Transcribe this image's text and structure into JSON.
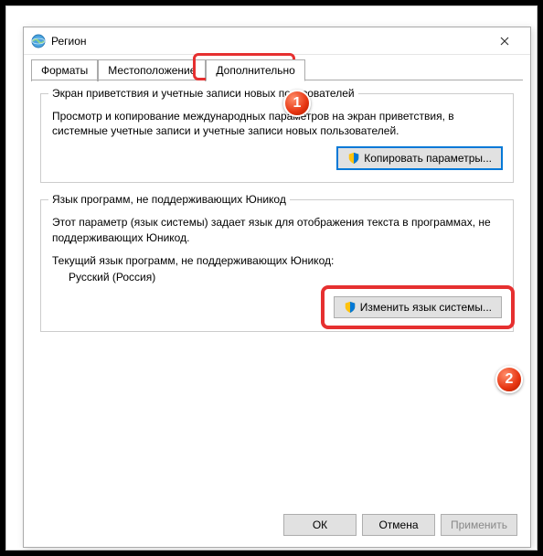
{
  "window": {
    "title": "Регион"
  },
  "tabs": {
    "formats": "Форматы",
    "location": "Местоположение",
    "advanced": "Дополнительно"
  },
  "group1": {
    "legend": "Экран приветствия и учетные записи новых пользователей",
    "desc": "Просмотр и копирование международных параметров на экран приветствия, в системные учетные записи и учетные записи новых пользователей.",
    "button": "Копировать параметры..."
  },
  "group2": {
    "legend": "Язык программ, не поддерживающих Юникод",
    "desc": "Этот параметр (язык системы) задает язык для отображения текста в программах, не поддерживающих Юникод.",
    "current_label": "Текущий язык программ, не поддерживающих Юникод:",
    "current_value": "Русский (Россия)",
    "button": "Изменить язык системы..."
  },
  "footer": {
    "ok": "ОК",
    "cancel": "Отмена",
    "apply": "Применить"
  },
  "markers": {
    "m1": "1",
    "m2": "2"
  }
}
